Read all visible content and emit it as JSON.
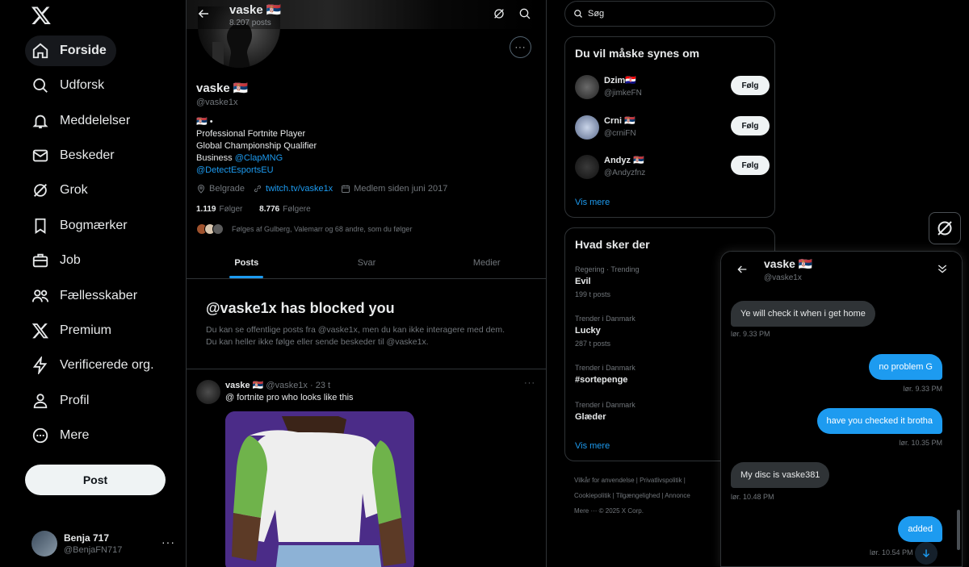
{
  "nav": {
    "items": [
      {
        "label": "Forside",
        "icon": "home-icon"
      },
      {
        "label": "Udforsk",
        "icon": "search-icon"
      },
      {
        "label": "Meddelelser",
        "icon": "bell-icon"
      },
      {
        "label": "Beskeder",
        "icon": "mail-icon"
      },
      {
        "label": "Grok",
        "icon": "grok-icon"
      },
      {
        "label": "Bogmærker",
        "icon": "bookmark-icon"
      },
      {
        "label": "Job",
        "icon": "briefcase-icon"
      },
      {
        "label": "Fællesskaber",
        "icon": "people-icon"
      },
      {
        "label": "Premium",
        "icon": "x-logo-icon"
      },
      {
        "label": "Verificerede org.",
        "icon": "lightning-icon"
      },
      {
        "label": "Profil",
        "icon": "person-icon"
      },
      {
        "label": "Mere",
        "icon": "more-circle-icon"
      }
    ],
    "post_label": "Post",
    "account": {
      "name": "Benja 717",
      "handle": "@BenjaFN717"
    }
  },
  "profile": {
    "header_name": "vaske 🇷🇸",
    "post_count": "8.207 posts",
    "name": "vaske 🇷🇸",
    "handle": "@vaske1x",
    "bio_line1": "🇷🇸 •",
    "bio_line2": "Professional Fortnite Player",
    "bio_line3": "Global Championship Qualifier",
    "bio_line4_prefix": "Business ",
    "bio_line4_link": "@ClapMNG",
    "bio_line5_link": "@DetectEsportsEU",
    "location": "Belgrade",
    "website": "twitch.tv/vaske1x",
    "joined": "Medlem siden juni 2017",
    "following_count": "1.119",
    "following_label": "Følger",
    "followers_count": "8.776",
    "followers_label": "Følgere",
    "followed_by": "Følges af Gulberg, Valemarr og 68 andre, som du følger",
    "tabs": [
      "Posts",
      "Svar",
      "Medier"
    ],
    "blocked_title": "@vaske1x has blocked you",
    "blocked_text_1": "Du kan se offentlige posts fra @vaske1x, men du kan ikke interagere med dem.",
    "blocked_text_2": "Du kan heller ikke følge eller sende beskeder til @vaske1x."
  },
  "tweet": {
    "name": "vaske 🇷🇸",
    "meta": "@vaske1x · 23 t",
    "text": "@ fortnite pro who looks like this"
  },
  "sidebar": {
    "search_placeholder": "Søg",
    "who_to_follow_title": "Du vil måske synes om",
    "suggestions": [
      {
        "name": "Dzim🇭🇷",
        "handle": "@jimkeFN",
        "button": "Følg"
      },
      {
        "name": "Crni 🇷🇸",
        "handle": "@crniFN",
        "button": "Følg"
      },
      {
        "name": "Andyz 🇷🇸",
        "handle": "@Andyzfnz",
        "button": "Følg"
      }
    ],
    "show_more": "Vis mere",
    "trends_title": "Hvad sker der",
    "trends": [
      {
        "context": "Regering · Trending",
        "topic": "Evil",
        "posts": "199 t posts"
      },
      {
        "context": "Trender i Danmark",
        "topic": "Lucky",
        "posts": "287 t posts"
      },
      {
        "context": "Trender i Danmark",
        "topic": "#sortepenge",
        "posts": ""
      },
      {
        "context": "Trender i Danmark",
        "topic": "Glæder",
        "posts": ""
      }
    ],
    "trends_show_more": "Vis mere",
    "footer_line1": "Vilkår for anvendelse  |  Privatlivspolitik  |",
    "footer_line2": "Cookiepolitik  |  Tilgængelighed  |  Annonce",
    "footer_line3": "Mere ···  © 2025 X Corp."
  },
  "dm": {
    "name": "vaske 🇷🇸",
    "handle": "@vaske1x",
    "messages": [
      {
        "text": "Ye will check it when i get home",
        "time": "lør. 9.33 PM",
        "dir": "in"
      },
      {
        "text": "no problem  G",
        "time": "lør. 9.33 PM",
        "dir": "out"
      },
      {
        "text": "have you checked it brotha",
        "time": "lør. 10.35 PM",
        "dir": "out"
      },
      {
        "text": "My disc is vaske381",
        "time": "lør. 10.48 PM",
        "dir": "in"
      },
      {
        "text": "added",
        "time": "lør. 10.54 PM",
        "dir": "out"
      }
    ]
  }
}
